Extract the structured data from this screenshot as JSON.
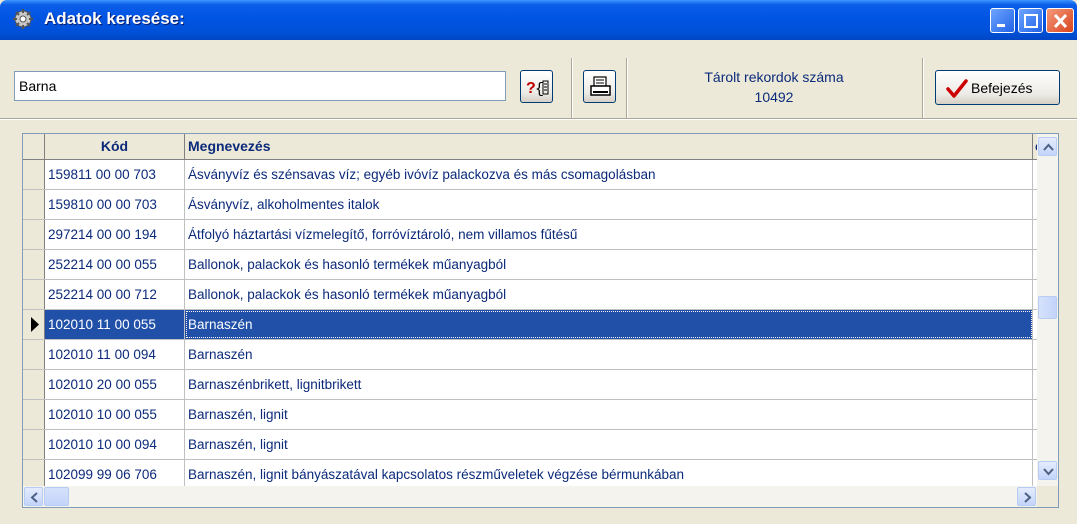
{
  "window": {
    "title": "Adatok keresése:",
    "icon": "gear-icon",
    "controls": [
      "minimize-icon",
      "maximize-icon",
      "close-icon"
    ]
  },
  "toolbar": {
    "search_value": "Barna",
    "help_icon": "help-search-icon",
    "print_icon": "printer-icon",
    "record_count_label": "Tárolt rekordok száma",
    "record_count_value": "10492",
    "finish_label": "Befejezés",
    "finish_icon": "checkmark-icon"
  },
  "grid": {
    "columns": [
      "Kód",
      "Megnevezés",
      "eg"
    ],
    "rows": [
      {
        "code": "159811 00 00 703",
        "name": "Ásványvíz és szénsavas víz; egyéb ivóvíz palackozva és más csomagolásban"
      },
      {
        "code": "159810 00 00 703",
        "name": "Ásványvíz, alkoholmentes italok"
      },
      {
        "code": "297214 00 00 194",
        "name": "Átfolyó háztartási vízmelegítő, forróvíztároló, nem villamos fűtésű"
      },
      {
        "code": "252214 00 00 055",
        "name": "Ballonok, palackok és hasonló termékek műanyagból"
      },
      {
        "code": "252214 00 00 712",
        "name": "Ballonok, palackok és hasonló termékek műanyagból"
      },
      {
        "code": "102010 11 00 055",
        "name": "Barnaszén"
      },
      {
        "code": "102010 11 00 094",
        "name": "Barnaszén"
      },
      {
        "code": "102010 20 00 055",
        "name": "Barnaszénbrikett, lignitbrikett"
      },
      {
        "code": "102010 10 00 055",
        "name": "Barnaszén, lignit"
      },
      {
        "code": "102010 10 00 094",
        "name": "Barnaszén, lignit"
      },
      {
        "code": "102099 99 06 706",
        "name": "Barnaszén, lignit bányászatával kapcsolatos részműveletek végzése bérmunkában"
      }
    ],
    "selected_index": 5
  },
  "colors": {
    "titlebar": "#0054e3",
    "selection": "#2050a8",
    "text": "#0b2a7a",
    "close_button": "#d8441c",
    "check": "#cc0000"
  }
}
